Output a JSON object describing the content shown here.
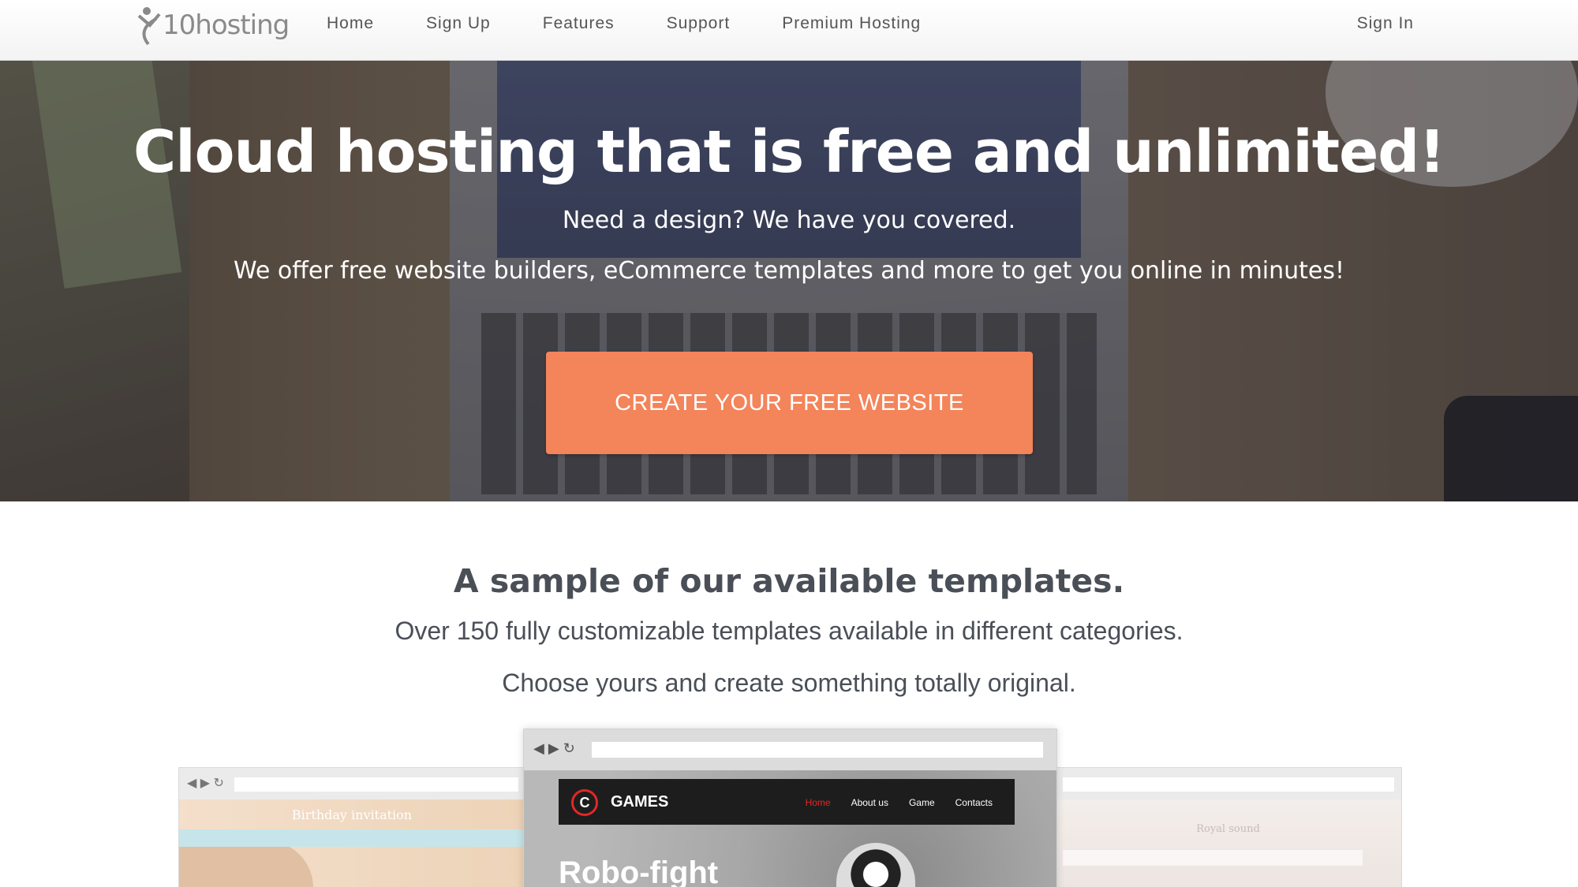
{
  "nav": {
    "logo_text": "10hosting",
    "links": [
      "Home",
      "Sign Up",
      "Features",
      "Support",
      "Premium Hosting"
    ],
    "signin": "Sign In"
  },
  "hero": {
    "title": "Cloud hosting that is free and unlimited!",
    "subtitle": "Need a design? We have you covered.",
    "description": "We offer free website builders, eCommerce templates and more to get you online in minutes!",
    "cta": "CREATE YOUR FREE WEBSITE"
  },
  "templates": {
    "title": "A sample of our available templates.",
    "line1": "Over 150 fully customizable templates available in different categories.",
    "line2": "Choose yours and create something totally original.",
    "left_preview": {
      "title": "Birthday invitation"
    },
    "center_preview": {
      "logo_letter": "C",
      "brand": "GAMES",
      "menu": [
        "Home",
        "About us",
        "Game",
        "Contacts"
      ],
      "headline": "Robo-fight"
    },
    "right_preview": {
      "title": "Royal sound"
    }
  },
  "colors": {
    "cta": "#f4845a",
    "games_accent": "#e02828"
  }
}
